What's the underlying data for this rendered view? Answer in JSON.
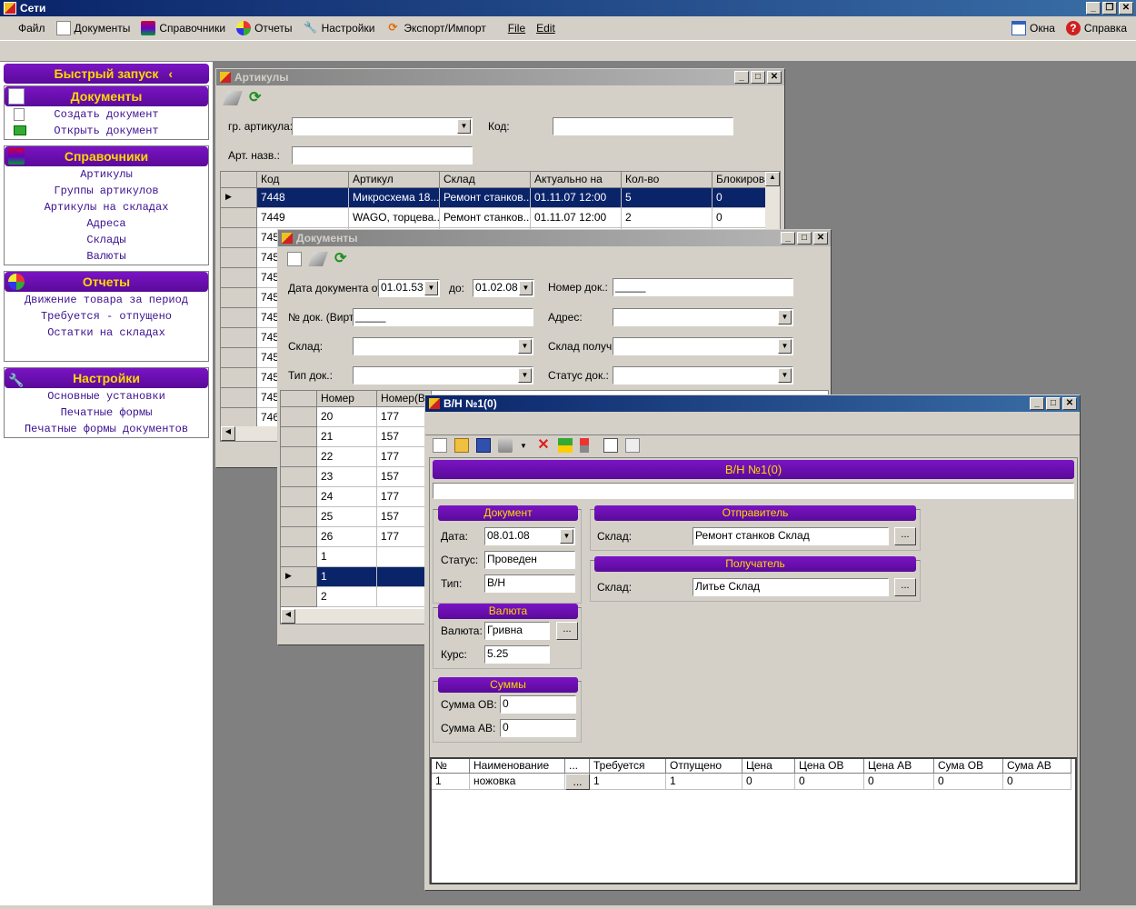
{
  "app": {
    "title": "Сети",
    "menu": [
      "Файл",
      "Документы",
      "Справочники",
      "Отчеты",
      "Настройки",
      "Экспорт/Импорт",
      "File",
      "Edit"
    ],
    "menu_right": [
      "Окна",
      "Справка"
    ]
  },
  "sidebar": {
    "quick_launch": "Быстрый запуск",
    "groups": [
      {
        "title": "Документы",
        "items": [
          "Создать документ",
          "Открыть документ"
        ]
      },
      {
        "title": "Справочники",
        "items": [
          "Артикулы",
          "Группы артикулов",
          "Артикулы на складах",
          "Адреса",
          "Склады",
          "Валюты"
        ]
      },
      {
        "title": "Отчеты",
        "items": [
          "Движение товара за период",
          "Требуется - отпущено",
          "Остатки на складах"
        ]
      },
      {
        "title": "Настройки",
        "items": [
          "Основные установки",
          "Печатные формы",
          "Печатные формы документов"
        ]
      }
    ]
  },
  "articles_window": {
    "title": "Артикулы",
    "labels": {
      "group": "гр. артикула:",
      "code": "Код:",
      "name": "Арт. назв.:"
    },
    "columns": [
      "Код",
      "Артикул",
      "Склад",
      "Актуально на",
      "Кол-во",
      "Блокирова"
    ],
    "rows": [
      [
        "7448",
        "Микросхема 18...",
        "Ремонт станков...",
        "01.11.07 12:00",
        "5",
        "0"
      ],
      [
        "7449",
        "WAGO, торцева...",
        "Ремонт станков...",
        "01.11.07 12:00",
        "2",
        "0"
      ]
    ],
    "partial_codes": [
      "745",
      "745",
      "745",
      "745",
      "745",
      "745",
      "745",
      "745",
      "745",
      "746"
    ]
  },
  "documents_window": {
    "title": "Документы",
    "labels": {
      "date_from": "Дата документа от:",
      "to": "до:",
      "doc_number": "Номер док.:",
      "virt_number": "№ док. (Вирт):",
      "address": "Адрес:",
      "warehouse": "Склад:",
      "warehouse_recv": "Склад получ.:",
      "doc_type": "Тип док.:",
      "doc_status": "Статус док.:"
    },
    "values": {
      "date_from": "01.01.53",
      "date_to": "01.02.08",
      "doc_number": "_____",
      "virt_number": "_____"
    },
    "columns": [
      "Номер",
      "Номер(В"
    ],
    "rows": [
      [
        "20",
        "177"
      ],
      [
        "21",
        "157"
      ],
      [
        "22",
        "177"
      ],
      [
        "23",
        "157"
      ],
      [
        "24",
        "177"
      ],
      [
        "25",
        "157"
      ],
      [
        "26",
        "177"
      ],
      [
        "1",
        ""
      ],
      [
        "1",
        ""
      ],
      [
        "2",
        ""
      ]
    ]
  },
  "invoice_window": {
    "title": "В/Н №1(0)",
    "header": "В/Н №1(0)",
    "sections": {
      "document": "Документ",
      "sender": "Отправитель",
      "receiver": "Получатель",
      "currency": "Валюта",
      "sums": "Суммы"
    },
    "labels": {
      "date": "Дата:",
      "status": "Статус:",
      "type": "Тип:",
      "sender_wh": "Склад:",
      "receiver_wh": "Склад:",
      "currency": "Валюта:",
      "rate": "Курс:",
      "sum_ov": "Сумма ОВ:",
      "sum_av": "Сумма АВ:"
    },
    "values": {
      "date": "08.01.08",
      "status": "Проведен",
      "type": "В/Н",
      "sender_wh": "Ремонт станков Склад",
      "receiver_wh": "Литье Склад",
      "currency": "Гривна",
      "rate": "5.25",
      "sum_ov": "0",
      "sum_av": "0"
    },
    "dots": "...",
    "columns": [
      "№",
      "Наименование",
      "...",
      "Требуется",
      "Отпущено",
      "Цена",
      "Цена ОВ",
      "Цена АВ",
      "Сума ОВ",
      "Сума АВ"
    ],
    "rows": [
      [
        "1",
        "ножовка",
        "...",
        "1",
        "1",
        "0",
        "0",
        "0",
        "0",
        "0"
      ]
    ]
  }
}
